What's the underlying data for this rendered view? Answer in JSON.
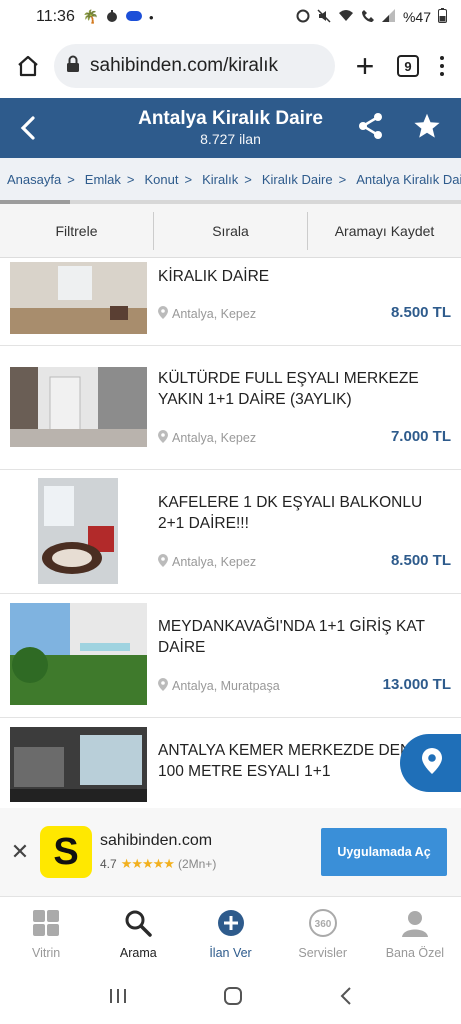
{
  "status_bar": {
    "time": "11:36",
    "battery": "%47"
  },
  "browser": {
    "url": "sahibinden.com/kiralık",
    "tab_count": "9"
  },
  "header": {
    "title": "Antalya Kiralık Daire",
    "subtitle": "8.727 ilan"
  },
  "breadcrumb": [
    "Anasayfa",
    "Emlak",
    "Konut",
    "Kiralık",
    "Kiralık Daire",
    "Antalya Kiralık Daire"
  ],
  "filters": {
    "filter": "Filtrele",
    "sort": "Sırala",
    "save": "Aramayı Kaydet"
  },
  "listings": [
    {
      "title": "KİRALIK DAİRE",
      "location": "Antalya, Kepez",
      "price": "8.500 TL"
    },
    {
      "title": "KÜLTÜRDE FULL EŞYALI MERKEZE YAKIN 1+1 DAİRE (3AYLIK)",
      "location": "Antalya, Kepez",
      "price": "7.000 TL"
    },
    {
      "title": "KAFELERE 1 DK EŞYALI BALKONLU 2+1 DAİRE!!!",
      "location": "Antalya, Kepez",
      "price": "8.500 TL"
    },
    {
      "title": "MEYDANKAVAĞI'NDA 1+1 GİRİŞ KAT DAİRE",
      "location": "Antalya, Muratpaşa",
      "price": "13.000 TL"
    },
    {
      "title": "ANTALYA KEMER MERKEZDE DENİZE 100 METRE ESYALI 1+1",
      "location": "",
      "price": ""
    }
  ],
  "app_banner": {
    "name": "sahibinden.com",
    "rating": "4.7",
    "reviews": "(2Mn+)",
    "cta": "Uygulamada Aç",
    "logo_letter": "S"
  },
  "bottom_nav": {
    "vitrin": "Vitrin",
    "arama": "Arama",
    "ilan_ver": "İlan Ver",
    "servisler": "Servisler",
    "bana_ozel": "Bana Özel"
  },
  "colors": {
    "brand_blue": "#2e5b8c",
    "accent_blue": "#3a8fd8",
    "logo_yellow": "#ffe800"
  }
}
